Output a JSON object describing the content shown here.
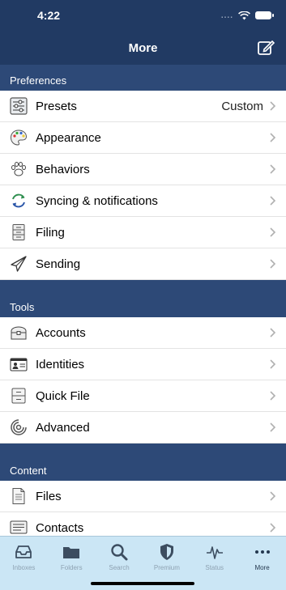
{
  "status": {
    "time": "4:22"
  },
  "nav": {
    "title": "More"
  },
  "sections": {
    "preferences": "Preferences",
    "tools": "Tools",
    "content": "Content"
  },
  "items": {
    "presets": {
      "label": "Presets",
      "detail": "Custom"
    },
    "appearance": {
      "label": "Appearance"
    },
    "behaviors": {
      "label": "Behaviors"
    },
    "syncing": {
      "label": "Syncing & notifications"
    },
    "filing": {
      "label": "Filing"
    },
    "sending": {
      "label": "Sending"
    },
    "accounts": {
      "label": "Accounts"
    },
    "identities": {
      "label": "Identities"
    },
    "quickfile": {
      "label": "Quick File"
    },
    "advanced": {
      "label": "Advanced"
    },
    "files": {
      "label": "Files"
    },
    "contacts": {
      "label": "Contacts"
    }
  },
  "tabs": [
    {
      "label": "Inboxes",
      "icon": "inbox-icon"
    },
    {
      "label": "Folders",
      "icon": "folder-icon"
    },
    {
      "label": "Search",
      "icon": "search-icon"
    },
    {
      "label": "Premium",
      "icon": "shield-icon"
    },
    {
      "label": "Status",
      "icon": "pulse-icon"
    },
    {
      "label": "More",
      "icon": "more-icon",
      "active": true
    }
  ],
  "colors": {
    "nav": "#213a63",
    "section": "#2d4977",
    "tabbar": "#cbe6f5"
  }
}
